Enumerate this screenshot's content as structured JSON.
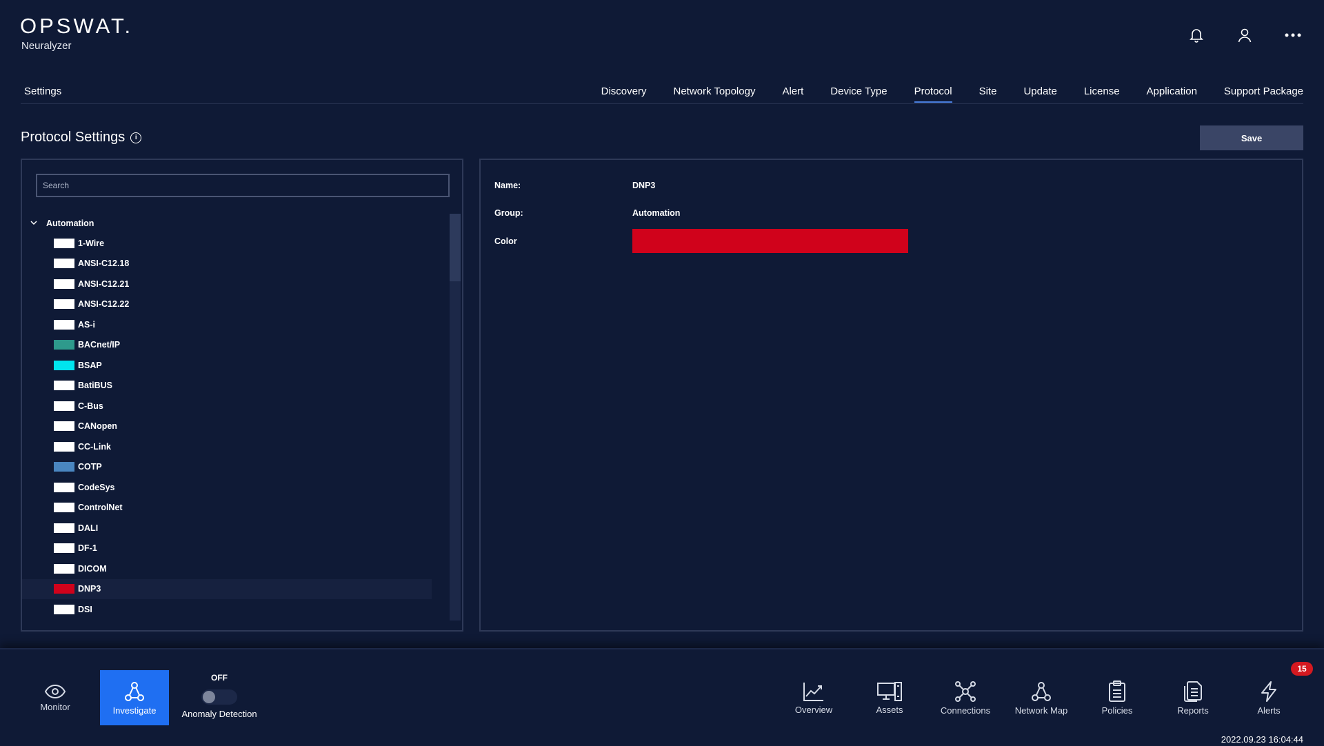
{
  "brand": {
    "name": "OPSWAT.",
    "product": "Neuralyzer"
  },
  "nav": {
    "settings_label": "Settings",
    "tabs": [
      {
        "label": "Discovery",
        "active": false
      },
      {
        "label": "Network Topology",
        "active": false
      },
      {
        "label": "Alert",
        "active": false
      },
      {
        "label": "Device Type",
        "active": false
      },
      {
        "label": "Protocol",
        "active": true
      },
      {
        "label": "Site",
        "active": false
      },
      {
        "label": "Update",
        "active": false
      },
      {
        "label": "License",
        "active": false
      },
      {
        "label": "Application",
        "active": false
      },
      {
        "label": "Support Package",
        "active": false
      }
    ]
  },
  "page": {
    "title": "Protocol Settings",
    "save_label": "Save"
  },
  "search": {
    "placeholder": "Search",
    "value": ""
  },
  "tree": {
    "group": "Automation",
    "expanded": true,
    "protocols": [
      {
        "name": "1-Wire",
        "color": "#ffffff"
      },
      {
        "name": "ANSI-C12.18",
        "color": "#ffffff"
      },
      {
        "name": "ANSI-C12.21",
        "color": "#ffffff"
      },
      {
        "name": "ANSI-C12.22",
        "color": "#ffffff"
      },
      {
        "name": "AS-i",
        "color": "#ffffff"
      },
      {
        "name": "BACnet/IP",
        "color": "#2e9a8c"
      },
      {
        "name": "BSAP",
        "color": "#00e5ee"
      },
      {
        "name": "BatiBUS",
        "color": "#ffffff"
      },
      {
        "name": "C-Bus",
        "color": "#ffffff"
      },
      {
        "name": "CANopen",
        "color": "#ffffff"
      },
      {
        "name": "CC-Link",
        "color": "#ffffff"
      },
      {
        "name": "COTP",
        "color": "#4a86c0"
      },
      {
        "name": "CodeSys",
        "color": "#ffffff"
      },
      {
        "name": "ControlNet",
        "color": "#ffffff"
      },
      {
        "name": "DALI",
        "color": "#ffffff"
      },
      {
        "name": "DF-1",
        "color": "#ffffff"
      },
      {
        "name": "DICOM",
        "color": "#ffffff"
      },
      {
        "name": "DNP3",
        "color": "#d0021b",
        "selected": true
      },
      {
        "name": "DSI",
        "color": "#ffffff"
      }
    ]
  },
  "details": {
    "name_label": "Name:",
    "name_value": "DNP3",
    "group_label": "Group:",
    "group_value": "Automation",
    "color_label": "Color",
    "color_value": "#d0021b"
  },
  "bottom": {
    "monitor": "Monitor",
    "investigate": "Investigate",
    "anomaly_state": "OFF",
    "anomaly_label": "Anomaly Detection",
    "overview": "Overview",
    "assets": "Assets",
    "connections": "Connections",
    "network_map": "Network Map",
    "policies": "Policies",
    "reports": "Reports",
    "alerts": "Alerts",
    "alerts_count": "15",
    "timestamp": "2022.09.23 16:04:44"
  }
}
